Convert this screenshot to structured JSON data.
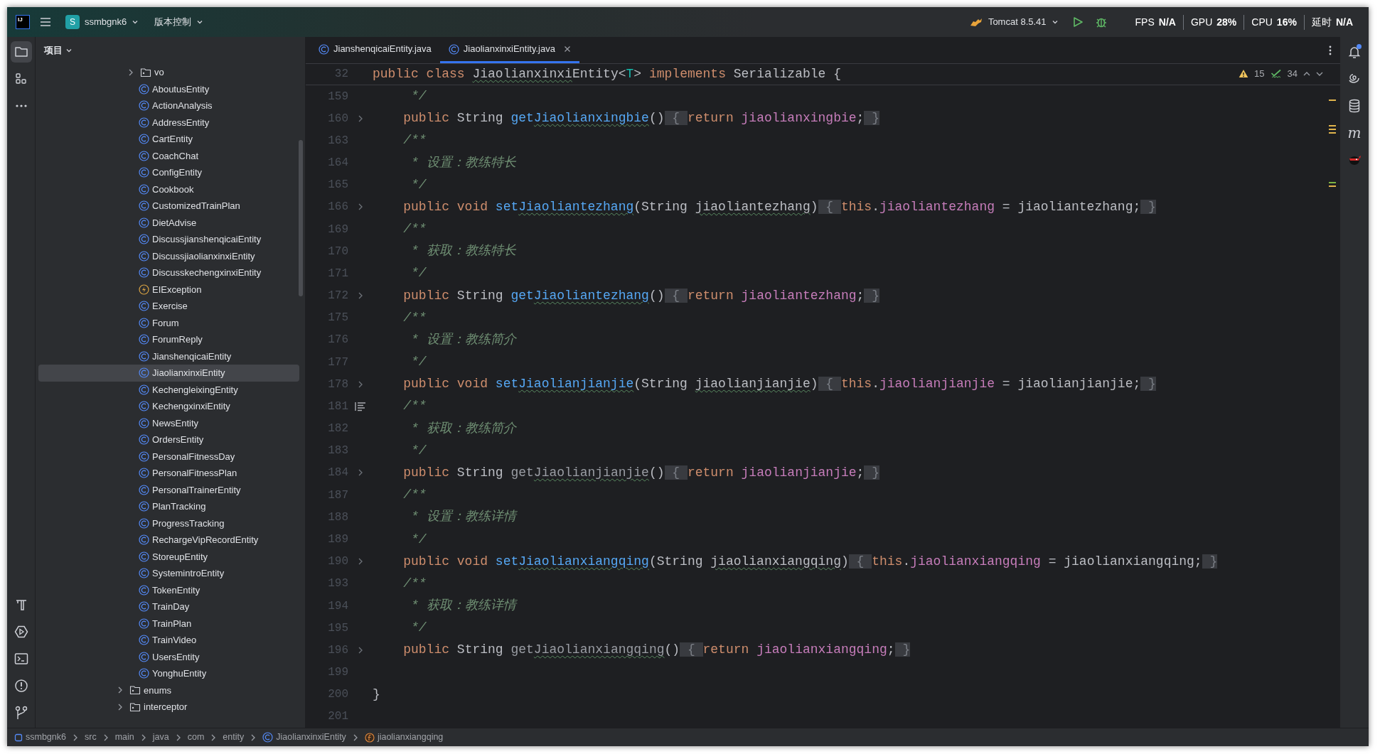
{
  "app_logo": "IJ",
  "project_switcher": {
    "badge": "S",
    "name": "ssmbgnk6"
  },
  "vcs_menu": {
    "label": "版本控制"
  },
  "run_config": {
    "label": "Tomcat 8.5.41"
  },
  "monitor": [
    {
      "label": "FPS",
      "value": "N/A"
    },
    {
      "label": "GPU",
      "value": "28%"
    },
    {
      "label": "CPU",
      "value": "16%"
    },
    {
      "label": "延时",
      "value": "N/A"
    }
  ],
  "left_tools": [
    {
      "kind": "folder",
      "selected": true
    },
    {
      "kind": "structure",
      "selected": false
    },
    {
      "kind": "more",
      "selected": false
    }
  ],
  "left_tools_bottom": [
    {
      "kind": "hammer",
      "selected": false
    },
    {
      "kind": "services",
      "selected": false
    },
    {
      "kind": "terminal",
      "selected": false
    },
    {
      "kind": "problems",
      "selected": false
    },
    {
      "kind": "git",
      "selected": false
    }
  ],
  "project_panel": {
    "title": "项目"
  },
  "tree": [
    {
      "children": [
        {
          "kind": "folder",
          "label": "vo",
          "expanded": false,
          "selected": false
        },
        {
          "kind": "class",
          "label": "AboutusEntity",
          "selected": false
        },
        {
          "kind": "class",
          "label": "ActionAnalysis",
          "selected": false
        },
        {
          "kind": "class",
          "label": "AddressEntity",
          "selected": false
        },
        {
          "kind": "class",
          "label": "CartEntity",
          "selected": false
        },
        {
          "kind": "class",
          "label": "CoachChat",
          "selected": false
        },
        {
          "kind": "class",
          "label": "ConfigEntity",
          "selected": false
        },
        {
          "kind": "class",
          "label": "Cookbook",
          "selected": false
        },
        {
          "kind": "class",
          "label": "CustomizedTrainPlan",
          "selected": false
        },
        {
          "kind": "class",
          "label": "DietAdvise",
          "selected": false
        },
        {
          "kind": "class",
          "label": "DiscussjianshenqicaiEntity",
          "selected": false
        },
        {
          "kind": "class",
          "label": "DiscussjiaolianxinxiEntity",
          "selected": false
        },
        {
          "kind": "class",
          "label": "DiscusskechengxinxiEntity",
          "selected": false
        },
        {
          "kind": "exception",
          "label": "EIException",
          "selected": false
        },
        {
          "kind": "class",
          "label": "Exercise",
          "selected": false
        },
        {
          "kind": "class",
          "label": "Forum",
          "selected": false
        },
        {
          "kind": "class",
          "label": "ForumReply",
          "selected": false
        },
        {
          "kind": "class",
          "label": "JianshenqicaiEntity",
          "selected": false
        },
        {
          "kind": "class",
          "label": "JiaolianxinxiEntity",
          "selected": true
        },
        {
          "kind": "class",
          "label": "KechengleixingEntity",
          "selected": false
        },
        {
          "kind": "class",
          "label": "KechengxinxiEntity",
          "selected": false
        },
        {
          "kind": "class",
          "label": "NewsEntity",
          "selected": false
        },
        {
          "kind": "class",
          "label": "OrdersEntity",
          "selected": false
        },
        {
          "kind": "class",
          "label": "PersonalFitnessDay",
          "selected": false
        },
        {
          "kind": "class",
          "label": "PersonalFitnessPlan",
          "selected": false
        },
        {
          "kind": "class",
          "label": "PersonalTrainerEntity",
          "selected": false
        },
        {
          "kind": "class",
          "label": "PlanTracking",
          "selected": false
        },
        {
          "kind": "class",
          "label": "ProgressTracking",
          "selected": false
        },
        {
          "kind": "class",
          "label": "RechargeVipRecordEntity",
          "selected": false
        },
        {
          "kind": "class",
          "label": "StoreupEntity",
          "selected": false
        },
        {
          "kind": "class",
          "label": "SystemintroEntity",
          "selected": false
        },
        {
          "kind": "class",
          "label": "TokenEntity",
          "selected": false
        },
        {
          "kind": "class",
          "label": "TrainDay",
          "selected": false
        },
        {
          "kind": "class",
          "label": "TrainPlan",
          "selected": false
        },
        {
          "kind": "class",
          "label": "TrainVideo",
          "selected": false
        },
        {
          "kind": "class",
          "label": "UsersEntity",
          "selected": false
        },
        {
          "kind": "class",
          "label": "YonghuEntity",
          "selected": false
        }
      ]
    },
    {
      "kind": "folder",
      "label": "enums",
      "expanded": false,
      "selected": false
    },
    {
      "kind": "folder",
      "label": "interceptor",
      "expanded": false,
      "selected": false
    }
  ],
  "tabs": [
    {
      "label": "JianshenqicaiEntity.java",
      "selected": false,
      "closable": false
    },
    {
      "label": "JiaolianxinxiEntity.java",
      "selected": true,
      "closable": true
    }
  ],
  "inspections": {
    "warnings": "15",
    "checks": "34"
  },
  "sticky_line": {
    "number": "32",
    "tokens": [
      {
        "kind": "kw",
        "text": "public class "
      },
      {
        "kind": "plain",
        "text": "Jiaolianxinxi",
        "typo": true
      },
      {
        "kind": "plain",
        "text": "Entity<"
      },
      {
        "kind": "tparam",
        "text": "T"
      },
      {
        "kind": "plain",
        "text": "> "
      },
      {
        "kind": "kw",
        "text": "implements "
      },
      {
        "kind": "plain",
        "text": "Serializable {"
      }
    ]
  },
  "code_lines": [
    {
      "number": "159",
      "tokens": [
        {
          "kind": "comment",
          "text": "     */"
        }
      ]
    },
    {
      "number": "160",
      "folded": true,
      "tokens": [
        {
          "kind": "kw",
          "text": "    public "
        },
        {
          "kind": "plain",
          "text": "String "
        },
        {
          "kind": "fn",
          "text": "get"
        },
        {
          "kind": "fn",
          "text": "Jiaolianxingbie",
          "typo": true
        },
        {
          "kind": "plain",
          "text": "()"
        },
        {
          "kind": "fold",
          "text": " { "
        },
        {
          "kind": "kw",
          "text": "return "
        },
        {
          "kind": "field",
          "text": "jiaolianxingbie"
        },
        {
          "kind": "plain",
          "text": ";"
        },
        {
          "kind": "fold",
          "text": " }"
        }
      ]
    },
    {
      "number": "163",
      "tokens": [
        {
          "kind": "comment",
          "text": "    /**"
        }
      ]
    },
    {
      "number": "164",
      "tokens": [
        {
          "kind": "comment",
          "text": "     * 设置：教练特长"
        }
      ]
    },
    {
      "number": "165",
      "tokens": [
        {
          "kind": "comment",
          "text": "     */"
        }
      ]
    },
    {
      "number": "166",
      "folded": true,
      "tokens": [
        {
          "kind": "kw",
          "text": "    public void "
        },
        {
          "kind": "fn",
          "text": "set"
        },
        {
          "kind": "fn",
          "text": "Jiaoliantezhang",
          "typo": true
        },
        {
          "kind": "plain",
          "text": "(String "
        },
        {
          "kind": "plain",
          "text": "jiaoliantezhang",
          "typo": true
        },
        {
          "kind": "plain",
          "text": ")"
        },
        {
          "kind": "fold",
          "text": " { "
        },
        {
          "kind": "kw",
          "text": "this"
        },
        {
          "kind": "plain",
          "text": "."
        },
        {
          "kind": "field",
          "text": "jiaoliantezhang"
        },
        {
          "kind": "plain",
          "text": " = jiaoliantezhang;"
        },
        {
          "kind": "fold",
          "text": " }"
        }
      ]
    },
    {
      "number": "169",
      "tokens": [
        {
          "kind": "comment",
          "text": "    /**"
        }
      ]
    },
    {
      "number": "170",
      "tokens": [
        {
          "kind": "comment",
          "text": "     * 获取：教练特长"
        }
      ]
    },
    {
      "number": "171",
      "tokens": [
        {
          "kind": "comment",
          "text": "     */"
        }
      ]
    },
    {
      "number": "172",
      "folded": true,
      "tokens": [
        {
          "kind": "kw",
          "text": "    public "
        },
        {
          "kind": "plain",
          "text": "String "
        },
        {
          "kind": "fn",
          "text": "get"
        },
        {
          "kind": "fn",
          "text": "Jiaoliantezhang",
          "typo": true
        },
        {
          "kind": "plain",
          "text": "()"
        },
        {
          "kind": "fold",
          "text": " { "
        },
        {
          "kind": "kw",
          "text": "return "
        },
        {
          "kind": "field",
          "text": "jiaoliantezhang"
        },
        {
          "kind": "plain",
          "text": ";"
        },
        {
          "kind": "fold",
          "text": " }"
        }
      ]
    },
    {
      "number": "175",
      "tokens": [
        {
          "kind": "comment",
          "text": "    /**"
        }
      ]
    },
    {
      "number": "176",
      "tokens": [
        {
          "kind": "comment",
          "text": "     * 设置：教练简介"
        }
      ]
    },
    {
      "number": "177",
      "tokens": [
        {
          "kind": "comment",
          "text": "     */"
        }
      ]
    },
    {
      "number": "178",
      "folded": true,
      "tokens": [
        {
          "kind": "kw",
          "text": "    public void "
        },
        {
          "kind": "fn",
          "text": "set"
        },
        {
          "kind": "fn",
          "text": "Jiaolianjianjie",
          "typo": true
        },
        {
          "kind": "plain",
          "text": "(String "
        },
        {
          "kind": "plain",
          "text": "jiaolianjianjie",
          "typo": true
        },
        {
          "kind": "plain",
          "text": ")"
        },
        {
          "kind": "fold",
          "text": " { "
        },
        {
          "kind": "kw",
          "text": "this"
        },
        {
          "kind": "plain",
          "text": "."
        },
        {
          "kind": "field",
          "text": "jiaolianjianjie"
        },
        {
          "kind": "plain",
          "text": " = jiaolianjianjie;"
        },
        {
          "kind": "fold",
          "text": " }"
        }
      ]
    },
    {
      "number": "181",
      "outline_icon": true,
      "tokens": [
        {
          "kind": "comment",
          "text": "    /**"
        }
      ]
    },
    {
      "number": "182",
      "tokens": [
        {
          "kind": "comment",
          "text": "     * 获取：教练简介"
        }
      ]
    },
    {
      "number": "183",
      "tokens": [
        {
          "kind": "comment",
          "text": "     */"
        }
      ]
    },
    {
      "number": "184",
      "folded": true,
      "tokens": [
        {
          "kind": "kw",
          "text": "    public "
        },
        {
          "kind": "plain",
          "text": "String "
        },
        {
          "kind": "unused",
          "text": "get"
        },
        {
          "kind": "unused",
          "text": "Jiaolianjianjie",
          "typo": true
        },
        {
          "kind": "plain",
          "text": "()"
        },
        {
          "kind": "fold",
          "text": " { "
        },
        {
          "kind": "kw",
          "text": "return "
        },
        {
          "kind": "field",
          "text": "jiaolianjianjie"
        },
        {
          "kind": "plain",
          "text": ";"
        },
        {
          "kind": "fold",
          "text": " }"
        }
      ]
    },
    {
      "number": "187",
      "tokens": [
        {
          "kind": "comment",
          "text": "    /**"
        }
      ]
    },
    {
      "number": "188",
      "tokens": [
        {
          "kind": "comment",
          "text": "     * 设置：教练详情"
        }
      ]
    },
    {
      "number": "189",
      "tokens": [
        {
          "kind": "comment",
          "text": "     */"
        }
      ]
    },
    {
      "number": "190",
      "folded": true,
      "tokens": [
        {
          "kind": "kw",
          "text": "    public void "
        },
        {
          "kind": "fn",
          "text": "set"
        },
        {
          "kind": "fn",
          "text": "Jiaolianxiangqing",
          "typo": true
        },
        {
          "kind": "plain",
          "text": "(String "
        },
        {
          "kind": "plain",
          "text": "jiaolianxiangqing",
          "typo": true
        },
        {
          "kind": "plain",
          "text": ")"
        },
        {
          "kind": "fold",
          "text": " { "
        },
        {
          "kind": "kw",
          "text": "this"
        },
        {
          "kind": "plain",
          "text": "."
        },
        {
          "kind": "field",
          "text": "jiaolianxiangqing"
        },
        {
          "kind": "plain",
          "text": " = jiaolianxiangqing;"
        },
        {
          "kind": "fold",
          "text": " }"
        }
      ]
    },
    {
      "number": "193",
      "tokens": [
        {
          "kind": "comment",
          "text": "    /**"
        }
      ]
    },
    {
      "number": "194",
      "tokens": [
        {
          "kind": "comment",
          "text": "     * 获取：教练详情"
        }
      ]
    },
    {
      "number": "195",
      "tokens": [
        {
          "kind": "comment",
          "text": "     */"
        }
      ]
    },
    {
      "number": "196",
      "folded": true,
      "tokens": [
        {
          "kind": "kw",
          "text": "    public "
        },
        {
          "kind": "plain",
          "text": "String "
        },
        {
          "kind": "unused",
          "text": "get"
        },
        {
          "kind": "unused",
          "text": "Jiaolianxiangqing",
          "typo": true
        },
        {
          "kind": "plain",
          "text": "()"
        },
        {
          "kind": "fold",
          "text": " { "
        },
        {
          "kind": "kw",
          "text": "return "
        },
        {
          "kind": "field",
          "text": "jiaolianxiangqing"
        },
        {
          "kind": "plain",
          "text": ";"
        },
        {
          "kind": "fold",
          "text": " }"
        }
      ]
    },
    {
      "number": "199"
    },
    {
      "number": "200",
      "tokens": [
        {
          "kind": "plain",
          "text": "}"
        }
      ]
    },
    {
      "number": "201"
    }
  ],
  "right_tools": [
    {
      "kind": "bell",
      "badge": true
    },
    {
      "kind": "spiral"
    },
    {
      "kind": "database"
    },
    {
      "kind": "glyph",
      "text": "m"
    },
    {
      "kind": "ninja"
    }
  ],
  "breadcrumbs": [
    {
      "kind": "module",
      "label": "ssmbgnk6"
    },
    {
      "kind": "plain",
      "label": "src"
    },
    {
      "kind": "plain",
      "label": "main"
    },
    {
      "kind": "plain",
      "label": "java"
    },
    {
      "kind": "plain",
      "label": "com"
    },
    {
      "kind": "plain",
      "label": "entity"
    },
    {
      "kind": "class",
      "label": "JiaolianxinxiEntity"
    },
    {
      "kind": "method",
      "label": "jiaolianxiangqing"
    }
  ]
}
